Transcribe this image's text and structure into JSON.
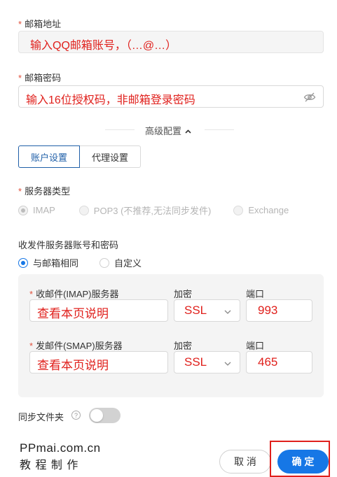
{
  "email": {
    "label": "邮箱地址",
    "value": "输入QQ邮箱账号，（…@…）"
  },
  "password": {
    "label": "邮箱密码",
    "value": "输入16位授权码，非邮箱登录密码"
  },
  "advanced": {
    "label": "高级配置"
  },
  "tabs": [
    {
      "label": "账户设置",
      "active": true
    },
    {
      "label": "代理设置",
      "active": false
    }
  ],
  "server_type": {
    "label": "服务器类型",
    "options": [
      {
        "label": "IMAP",
        "checked": true
      },
      {
        "label": "POP3 (不推荐,无法同步发件)",
        "checked": false
      },
      {
        "label": "Exchange",
        "checked": false
      }
    ]
  },
  "credentials": {
    "label": "收发件服务器账号和密码",
    "options": [
      {
        "label": "与邮箱相同",
        "checked": true
      },
      {
        "label": "自定义",
        "checked": false
      }
    ]
  },
  "incoming": {
    "label": "收邮件(IMAP)服务器",
    "server": "查看本页说明",
    "encrypt_label": "加密",
    "encrypt": "SSL",
    "port_label": "端口",
    "port": "993"
  },
  "outgoing": {
    "label": "发邮件(SMAP)服务器",
    "server": "查看本页说明",
    "encrypt_label": "加密",
    "encrypt": "SSL",
    "port_label": "端口",
    "port": "465"
  },
  "sync": {
    "label": "同步文件夹",
    "enabled": false
  },
  "watermark": {
    "line1": "PPmai.com.cn",
    "line2": "教 程 制 作"
  },
  "buttons": {
    "cancel": "取 消",
    "confirm": "确 定"
  },
  "colors": {
    "accent": "#1677e6",
    "highlight": "#e0201c",
    "required": "#e0503c"
  }
}
